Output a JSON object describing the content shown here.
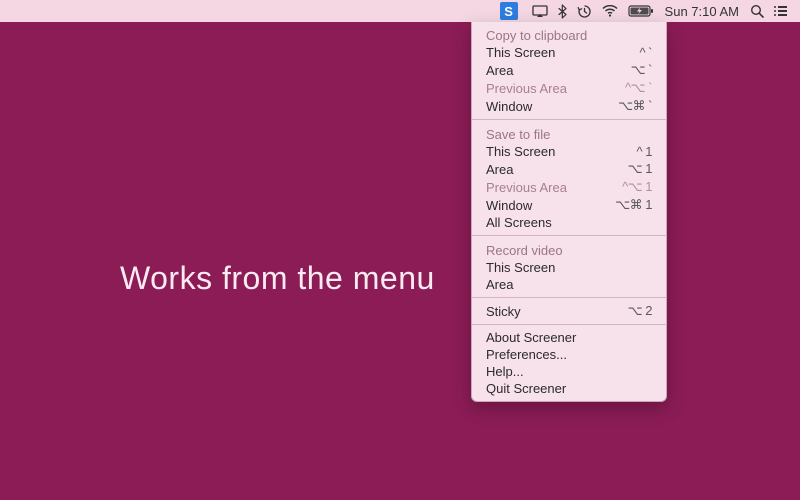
{
  "hero": {
    "text": "Works from the menu"
  },
  "menubar": {
    "app_letter": "S",
    "clock": "Sun 7:10 AM"
  },
  "menu": {
    "sections": [
      {
        "header": "Copy to clipboard",
        "items": [
          {
            "label": "This Screen",
            "shortcut": "^ `",
            "disabled": false
          },
          {
            "label": "Area",
            "shortcut": "⌥ `",
            "disabled": false
          },
          {
            "label": "Previous Area",
            "shortcut": "^⌥ `",
            "disabled": true
          },
          {
            "label": "Window",
            "shortcut": "⌥⌘ `",
            "disabled": false
          }
        ]
      },
      {
        "header": "Save to file",
        "items": [
          {
            "label": "This Screen",
            "shortcut": "^ 1",
            "disabled": false
          },
          {
            "label": "Area",
            "shortcut": "⌥ 1",
            "disabled": false
          },
          {
            "label": "Previous Area",
            "shortcut": "^⌥ 1",
            "disabled": true
          },
          {
            "label": "Window",
            "shortcut": "⌥⌘ 1",
            "disabled": false
          },
          {
            "label": "All Screens",
            "shortcut": "",
            "disabled": false
          }
        ]
      },
      {
        "header": "Record video",
        "items": [
          {
            "label": "This Screen",
            "shortcut": "",
            "disabled": false
          },
          {
            "label": "Area",
            "shortcut": "",
            "disabled": false
          }
        ]
      },
      {
        "items": [
          {
            "label": "Sticky",
            "shortcut": "⌥ 2",
            "disabled": false
          }
        ]
      },
      {
        "items": [
          {
            "label": "About Screener",
            "shortcut": "",
            "disabled": false
          },
          {
            "label": "Preferences...",
            "shortcut": "",
            "disabled": false
          },
          {
            "label": "Help...",
            "shortcut": "",
            "disabled": false
          },
          {
            "label": "Quit Screener",
            "shortcut": "",
            "disabled": false
          }
        ]
      }
    ]
  }
}
